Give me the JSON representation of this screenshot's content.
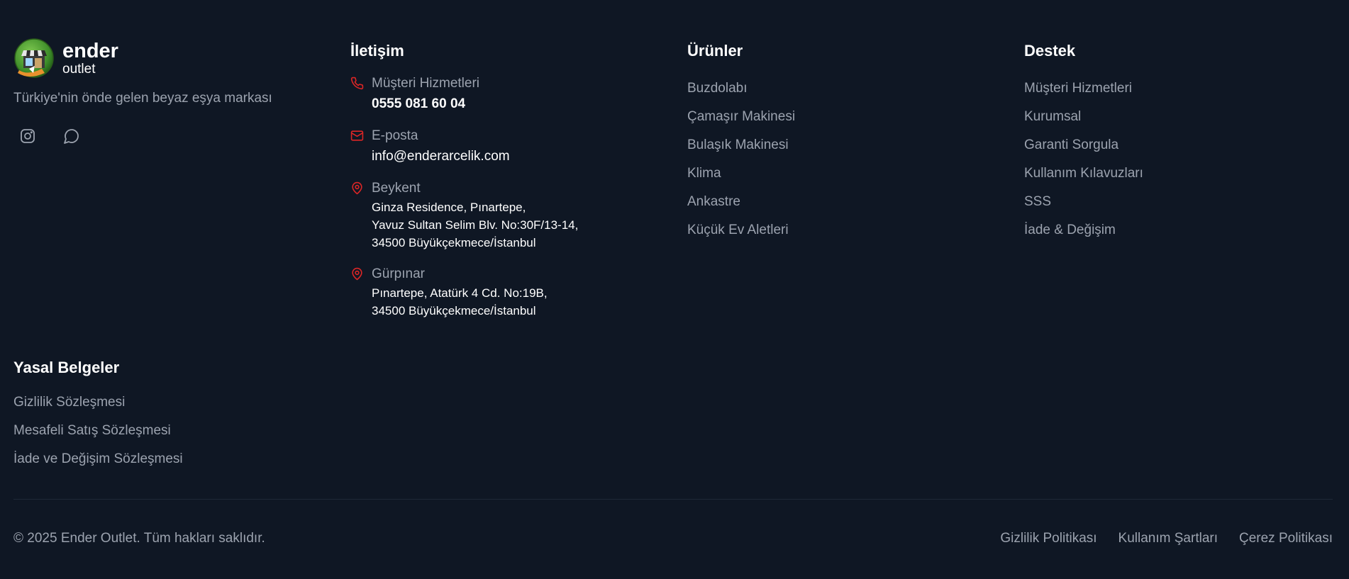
{
  "brand": {
    "name": "ender",
    "sub": "outlet",
    "tagline": "Türkiye'nin önde gelen beyaz eşya markası",
    "logo_icon": "storefront-logo",
    "social": [
      {
        "icon": "instagram-icon"
      },
      {
        "icon": "chat-bubble-icon"
      }
    ]
  },
  "contact": {
    "heading": "İletişim",
    "phone_label": "Müşteri Hizmetleri",
    "phone_value": "0555 081 60 04",
    "email_label": "E-posta",
    "email_value": "info@enderarcelik.com",
    "beykent_label": "Beykent",
    "beykent_line1": "Ginza Residence, Pınartepe,",
    "beykent_line2": "Yavuz Sultan Selim Blv. No:30F/13-14,",
    "beykent_line3": "34500 Büyükçekmece/İstanbul",
    "gurpinar_label": "Gürpınar",
    "gurpinar_line1": "Pınartepe, Atatürk 4 Cd. No:19B,",
    "gurpinar_line2": "34500 Büyükçekmece/İstanbul"
  },
  "products": {
    "heading": "Ürünler",
    "items": [
      "Buzdolabı",
      "Çamaşır Makinesi",
      "Bulaşık Makinesi",
      "Klima",
      "Ankastre",
      "Küçük Ev Aletleri"
    ]
  },
  "support": {
    "heading": "Destek",
    "items": [
      "Müşteri Hizmetleri",
      "Kurumsal",
      "Garanti Sorgula",
      "Kullanım Kılavuzları",
      "SSS",
      "İade & Değişim"
    ]
  },
  "legal": {
    "heading": "Yasal Belgeler",
    "items": [
      "Gizlilik Sözleşmesi",
      "Mesafeli Satış Sözleşmesi",
      "İade ve Değişim Sözleşmesi"
    ]
  },
  "bottom": {
    "copyright": "© 2025 Ender Outlet. Tüm hakları saklıdır.",
    "links": [
      "Gizlilik Politikası",
      "Kullanım Şartları",
      "Çerez Politikası"
    ]
  },
  "colors": {
    "background": "#0f1724",
    "accent": "#dc2626",
    "muted_text": "#9ca3af",
    "heading_text": "#ffffff"
  }
}
